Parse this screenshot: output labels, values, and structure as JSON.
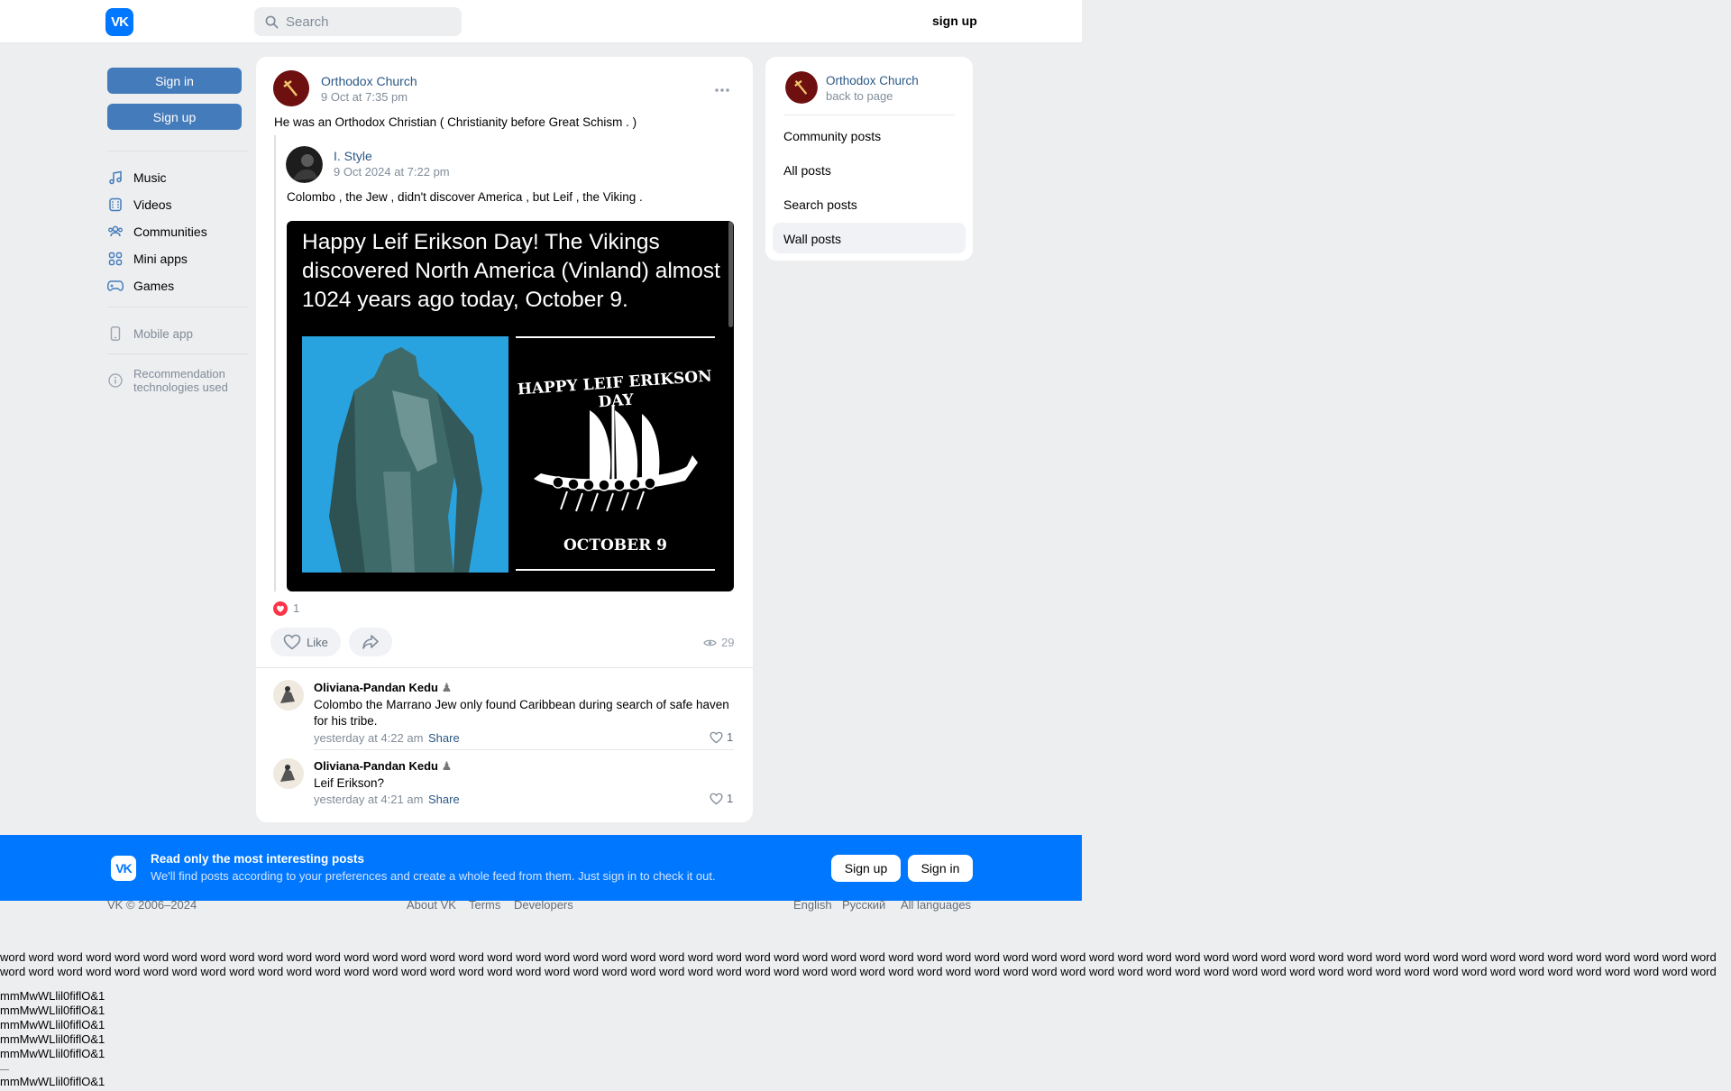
{
  "header": {
    "logo": "VK",
    "search_placeholder": "Search",
    "signup_label": "sign up"
  },
  "sidebar": {
    "signin_label": "Sign in",
    "signup_label": "Sign up",
    "items": [
      {
        "label": "Music",
        "icon": "music-icon"
      },
      {
        "label": "Videos",
        "icon": "video-icon"
      },
      {
        "label": "Communities",
        "icon": "communities-icon"
      },
      {
        "label": "Mini apps",
        "icon": "apps-icon"
      },
      {
        "label": "Games",
        "icon": "gamepad-icon"
      }
    ],
    "mobile_app": "Mobile app",
    "recommendation_line1": "Recommendation",
    "recommendation_line2": "technologies used"
  },
  "post": {
    "author": "Orthodox Church",
    "date": "9 Oct at 7:35 pm",
    "text": "He was an Orthodox Christian ( Christianity before Great Schism . )",
    "repost": {
      "author": "I. Style",
      "date": "9 Oct 2024 at 7:22 pm",
      "text": "Colombo , the Jew , didn't discover America , but Leif , the Viking .",
      "image_caption": "Happy Leif Erikson Day! The Vikings discovered North America (Vinland) almost 1024 years ago today, October 9.",
      "poster_title": "HAPPY LEIF ERIKSON DAY",
      "poster_date": "OCTOBER 9"
    },
    "reactions_count": "1",
    "like_label": "Like",
    "views": "29"
  },
  "comments": [
    {
      "author": "Oliviana-Pandan Kedu",
      "line1": "Colombo the Marrano Jew only found Caribbean during search of safe haven",
      "line2": "for his tribe.",
      "time": "yesterday at 4:22 am",
      "share": "Share",
      "likes": "1"
    },
    {
      "author": "Oliviana-Pandan Kedu",
      "line1": "Leif Erikson?",
      "line2": "",
      "time": "yesterday at 4:21 am",
      "share": "Share",
      "likes": "1"
    }
  ],
  "right_card": {
    "title": "Orthodox Church",
    "subtitle": "back to page",
    "items": [
      "Community posts",
      "All posts",
      "Search posts",
      "Wall posts"
    ],
    "active_item": "Wall posts"
  },
  "banner": {
    "logo": "VK",
    "title": "Read only the most interesting posts",
    "subtitle": "We'll find posts according to your preferences and create a whole feed from them. Just sign in to check it out.",
    "signup_label": "Sign up",
    "signin_label": "Sign in"
  },
  "footer": {
    "copyright": "VK © 2006–2024",
    "links": [
      "About VK",
      "Terms",
      "Developers"
    ],
    "languages": [
      "English",
      "Русский",
      "All languages"
    ]
  },
  "filler": {
    "word_line": "word word word word word word word word word word word word word word word word word word word word word word word word word word word word word word word word word word word word word word word word word word word word word word word word word word word word word word word word word word word word",
    "glyph_line": "mmMwWLlil0fiflO&1"
  },
  "colors": {
    "accent": "#0077ff",
    "button": "#447bba",
    "link": "#2a5885",
    "background": "#edeef0"
  }
}
